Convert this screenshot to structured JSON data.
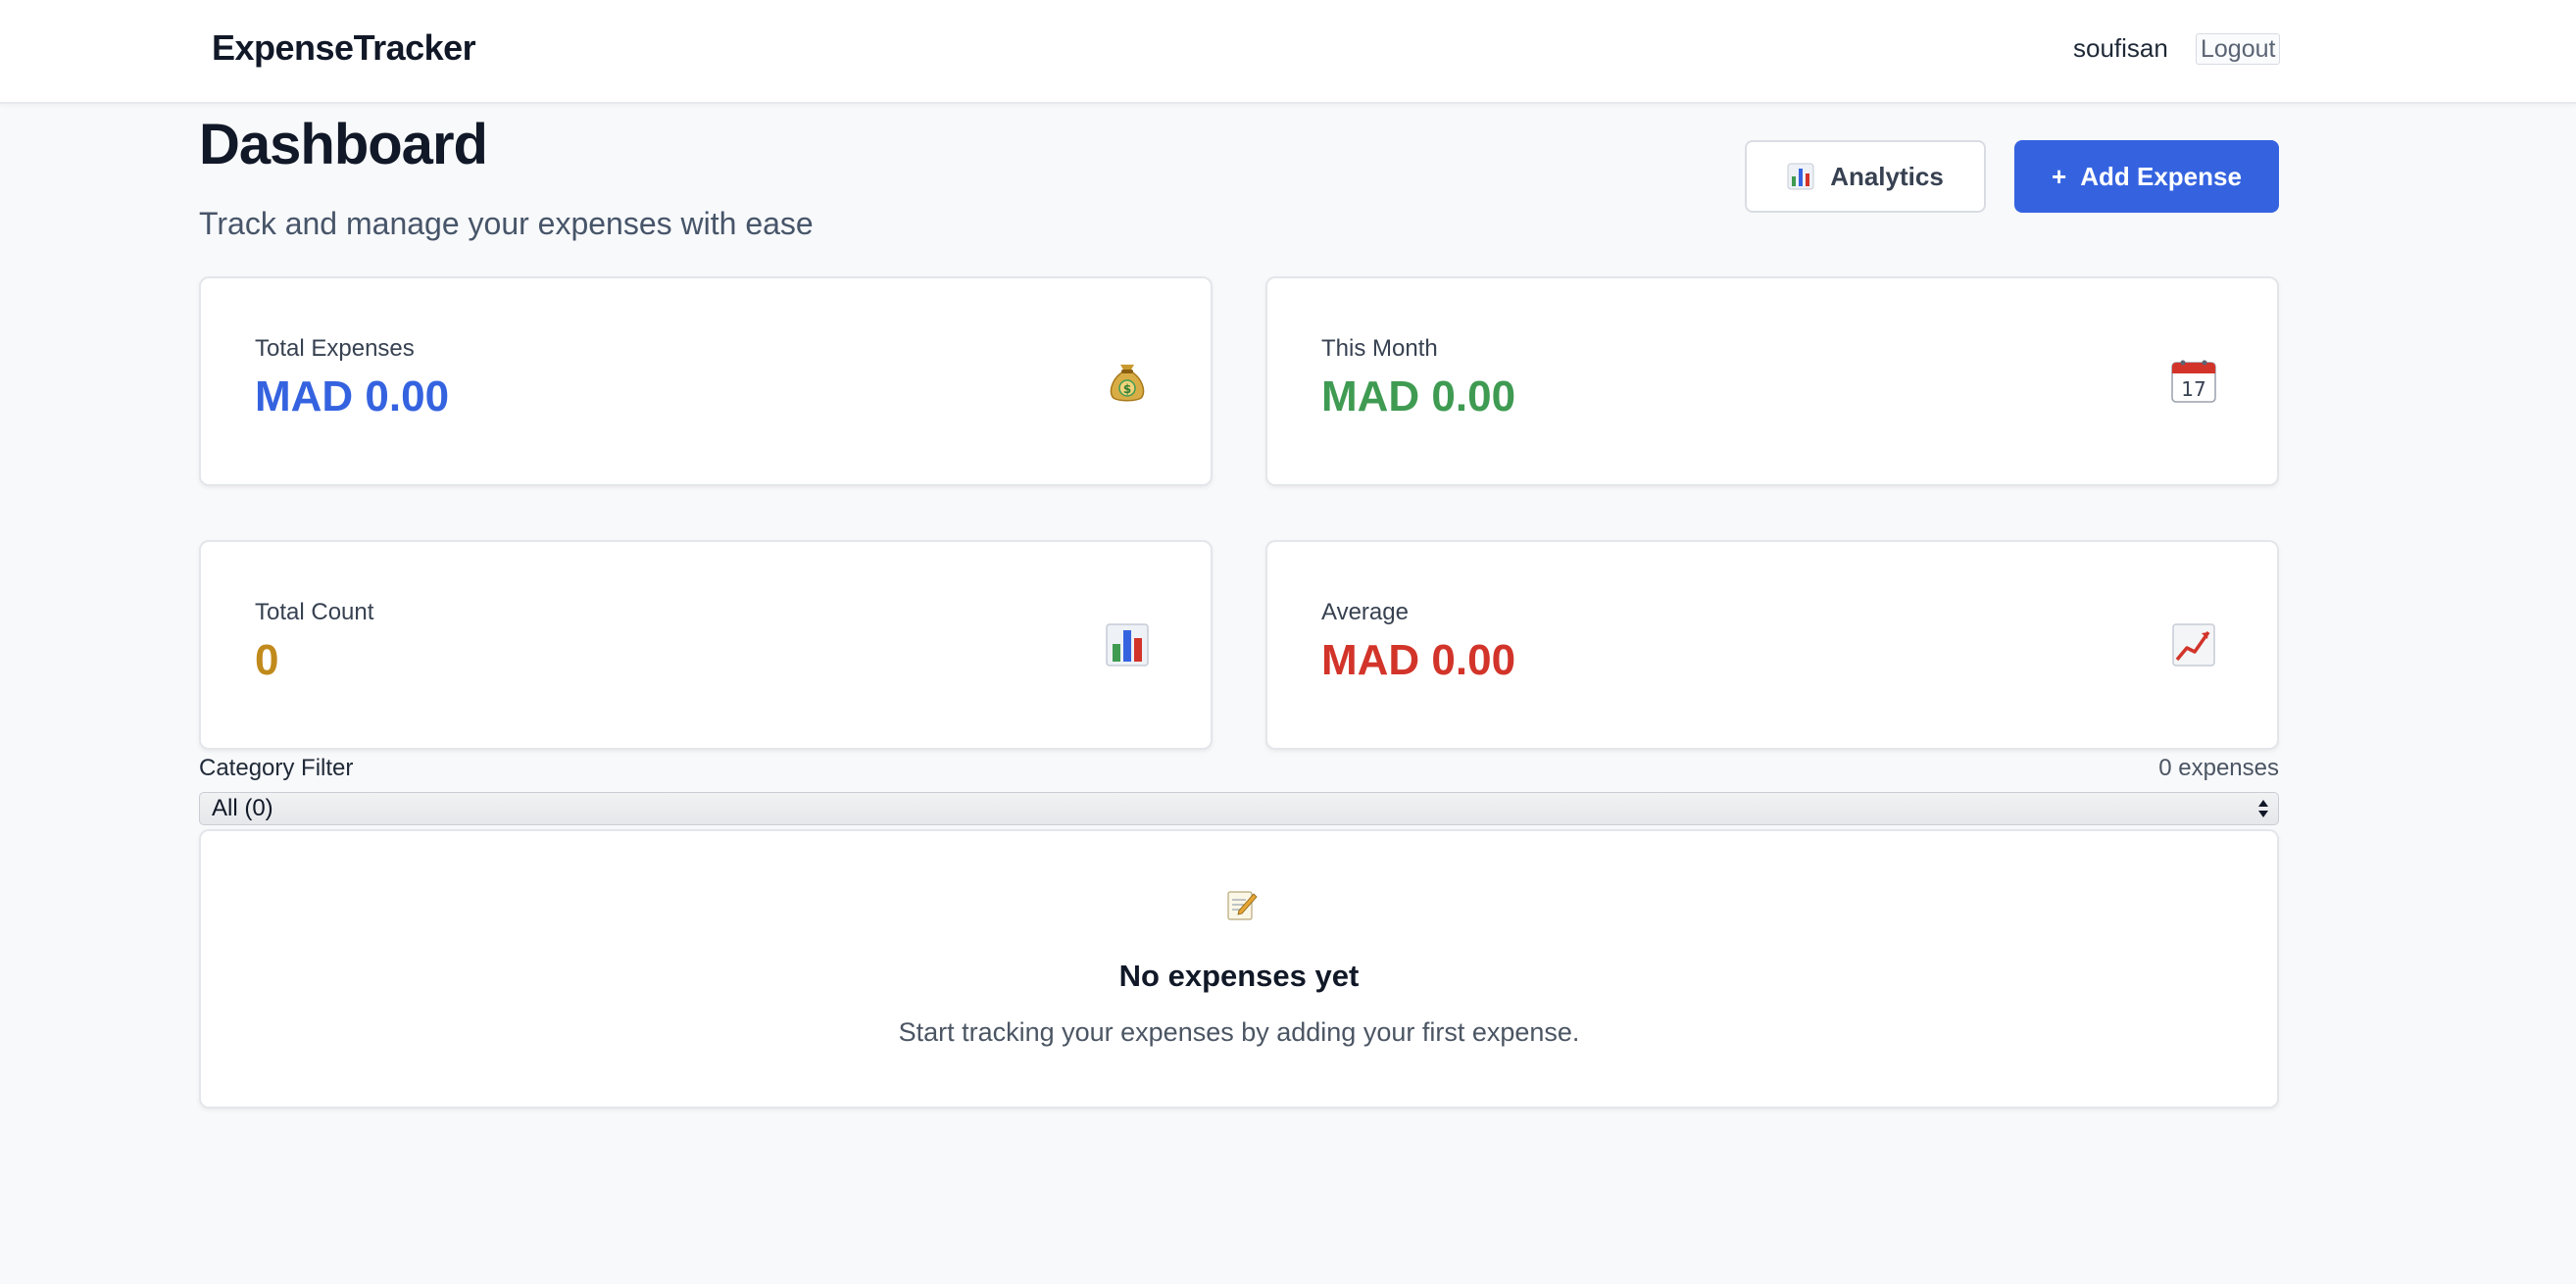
{
  "header": {
    "brand": "ExpenseTracker",
    "username": "soufisan",
    "logout_label": "Logout"
  },
  "page": {
    "title": "Dashboard",
    "subtitle": "Track and manage your expenses with ease"
  },
  "actions": {
    "analytics_label": "Analytics",
    "analytics_icon": "bar-chart-icon",
    "add_icon": "+",
    "add_label": "Add Expense"
  },
  "stats": [
    {
      "label": "Total Expenses",
      "value": "MAD 0.00",
      "color": "#3563e0",
      "icon": "money-bag-icon"
    },
    {
      "label": "This Month",
      "value": "MAD 0.00",
      "color": "#3f9b52",
      "icon": "calendar-icon"
    },
    {
      "label": "Total Count",
      "value": "0",
      "color": "#c18a1c",
      "icon": "bar-chart-icon"
    },
    {
      "label": "Average",
      "value": "MAD 0.00",
      "color": "#d2342a",
      "icon": "trend-up-icon"
    }
  ],
  "calendar_day": "17",
  "filter": {
    "label": "Category Filter",
    "count_text": "0 expenses",
    "selected": "All (0)"
  },
  "empty_state": {
    "icon": "memo-icon",
    "title": "No expenses yet",
    "text": "Start tracking your expenses by adding your first expense."
  },
  "colors": {
    "primary": "#3563e0",
    "background": "#f8f9fb"
  }
}
